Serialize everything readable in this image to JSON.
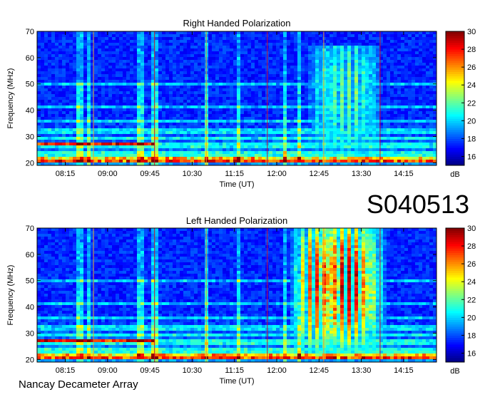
{
  "figure": {
    "observation_id": "S040513",
    "instrument": "Nancay Decameter Array"
  },
  "chart_data": [
    {
      "type": "heatmap",
      "title": "Right Handed Polarization",
      "xlabel": "Time (UT)",
      "ylabel": "Frequency (MHz)",
      "x_ticks": [
        "08:15",
        "09:00",
        "09:45",
        "10:30",
        "11:15",
        "12:00",
        "12:45",
        "13:30",
        "14:15"
      ],
      "y_ticks": [
        20,
        30,
        40,
        50,
        60,
        70
      ],
      "ylim": [
        19,
        70
      ],
      "colorbar": {
        "label": "dB",
        "ticks": [
          16,
          18,
          20,
          22,
          24,
          26,
          28,
          30
        ],
        "range": [
          15,
          30
        ]
      },
      "features": {
        "emission_event": {
          "time_start": "12:35",
          "time_end": "13:50",
          "freq_low": 20,
          "freq_high": 65,
          "peak_db": 22
        },
        "low_freq_interference": {
          "freq_low": 19,
          "freq_high": 28,
          "peak_db": 27
        },
        "vertical_markers": [
          "08:45",
          "09:50",
          "10:45",
          "11:50",
          "12:50",
          "13:50"
        ]
      }
    },
    {
      "type": "heatmap",
      "title": "Left Handed Polarization",
      "xlabel": "Time (UT)",
      "ylabel": "Frequency (MHz)",
      "x_ticks": [
        "08:15",
        "09:00",
        "09:45",
        "10:30",
        "11:15",
        "12:00",
        "12:45",
        "13:30",
        "14:15"
      ],
      "y_ticks": [
        20,
        30,
        40,
        50,
        60,
        70
      ],
      "ylim": [
        19,
        70
      ],
      "colorbar": {
        "label": "dB",
        "ticks": [
          16,
          18,
          20,
          22,
          24,
          26,
          28,
          30
        ],
        "range": [
          15,
          30
        ]
      },
      "features": {
        "emission_event": {
          "time_start": "12:15",
          "time_end": "13:55",
          "freq_low": 20,
          "freq_high": 70,
          "peak_db": 29
        },
        "low_freq_interference": {
          "freq_low": 19,
          "freq_high": 28,
          "peak_db": 28
        },
        "vertical_markers": [
          "08:45",
          "09:50",
          "10:45",
          "11:50",
          "12:50",
          "13:50"
        ]
      }
    }
  ]
}
